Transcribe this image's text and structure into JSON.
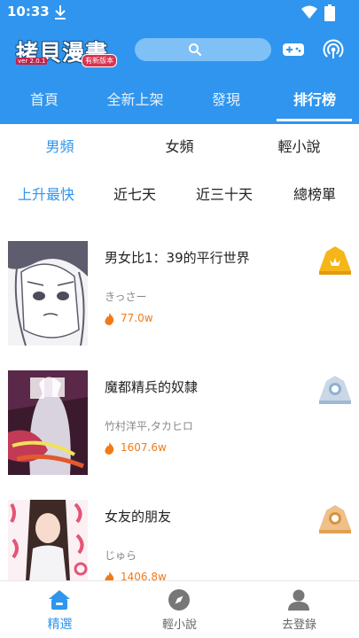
{
  "status_bar": {
    "time": "10:33"
  },
  "header": {
    "logo_text": "拷貝漫畫",
    "logo_version": "ver 2.0.1",
    "logo_badge": "有新版本",
    "search_placeholder": "",
    "tabs": [
      {
        "label": "首頁",
        "active": false
      },
      {
        "label": "全新上架",
        "active": false
      },
      {
        "label": "發現",
        "active": false
      },
      {
        "label": "排行榜",
        "active": true
      }
    ]
  },
  "gender_tabs": [
    {
      "label": "男頻",
      "active": true
    },
    {
      "label": "女頻",
      "active": false
    },
    {
      "label": "輕小說",
      "active": false
    }
  ],
  "period_tabs": [
    {
      "label": "上升最快",
      "active": true
    },
    {
      "label": "近七天",
      "active": false
    },
    {
      "label": "近三十天",
      "active": false
    },
    {
      "label": "總榜單",
      "active": false
    }
  ],
  "rankings": [
    {
      "title": "男女比1：39的平行世界",
      "author": "きっさー",
      "heat": "77.0w",
      "medal": "gold-medal-icon"
    },
    {
      "title": "魔都精兵的奴隸",
      "author": "竹村洋平,タカヒロ",
      "heat": "1607.6w",
      "medal": "silver-medal-icon"
    },
    {
      "title": "女友的朋友",
      "author": "じゅら",
      "heat": "1406.8w",
      "medal": "bronze-medal-icon"
    }
  ],
  "bottom_nav": [
    {
      "label": "精選",
      "icon": "home-icon",
      "active": true
    },
    {
      "label": "輕小說",
      "icon": "compass-icon",
      "active": false
    },
    {
      "label": "去登錄",
      "icon": "user-icon",
      "active": false
    }
  ],
  "colors": {
    "accent": "#2f95ee",
    "heat": "#f07a1a",
    "gold": "#f6b619",
    "silver": "#9fb9d6",
    "bronze": "#e0a050"
  }
}
